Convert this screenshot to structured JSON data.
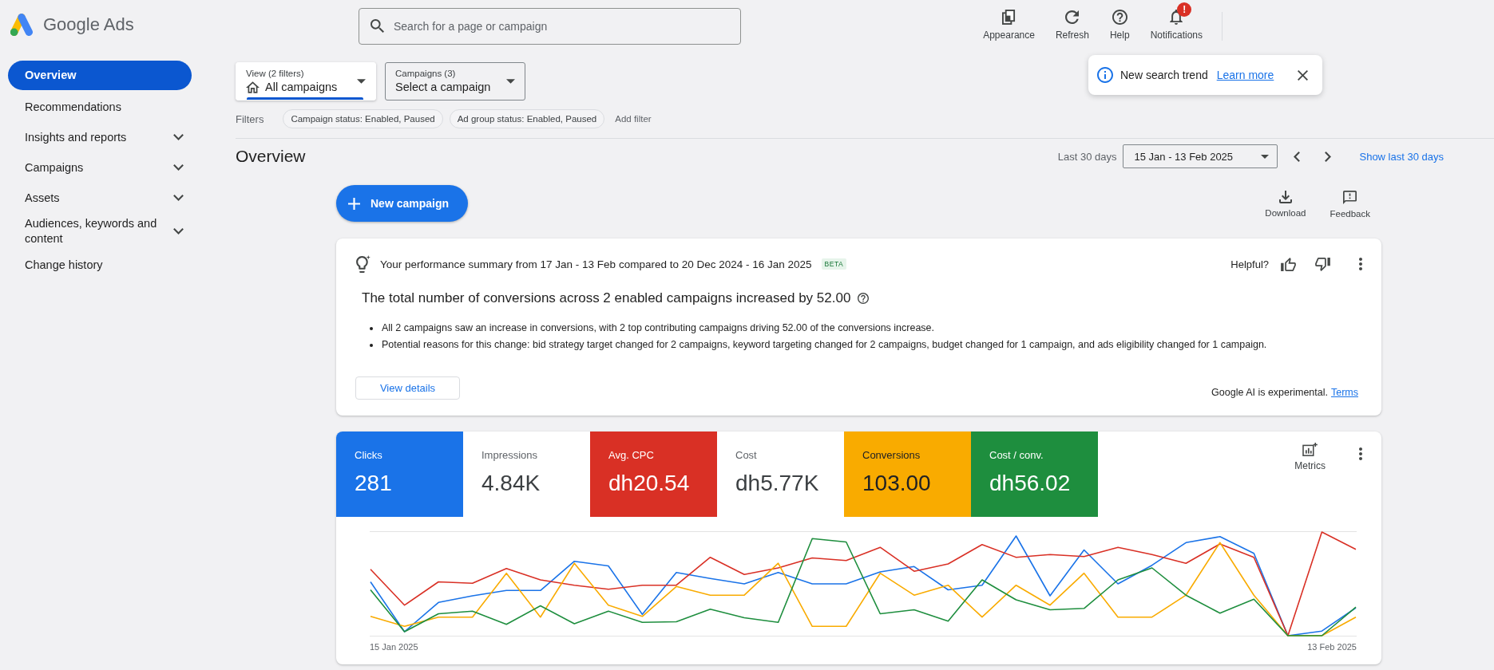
{
  "header": {
    "logo_text": "Google Ads",
    "search": {
      "placeholder": "Search for a page or campaign"
    },
    "actions": [
      {
        "kind": "appearance",
        "label": "Appearance"
      },
      {
        "kind": "refresh",
        "label": "Refresh"
      },
      {
        "kind": "help",
        "label": "Help"
      },
      {
        "kind": "notifications",
        "label": "Notifications",
        "badge": "!"
      }
    ]
  },
  "sidebar": {
    "items": [
      {
        "label": "Overview",
        "selected": true,
        "expandable": false
      },
      {
        "label": "Recommendations",
        "selected": false,
        "expandable": false
      },
      {
        "label": "Insights and reports",
        "selected": false,
        "expandable": true
      },
      {
        "label": "Campaigns",
        "selected": false,
        "expandable": true
      },
      {
        "label": "Assets",
        "selected": false,
        "expandable": true
      },
      {
        "label": "Audiences, keywords and content",
        "selected": false,
        "expandable": true
      },
      {
        "label": "Change history",
        "selected": false,
        "expandable": false
      }
    ]
  },
  "selectors": [
    {
      "kind": "view",
      "caption": "View (2 filters)",
      "value": "All campaigns",
      "selected": true
    },
    {
      "kind": "campaigns",
      "caption": "Campaigns (3)",
      "value": "Select a campaign",
      "selected": false
    }
  ],
  "filters": {
    "label": "Filters",
    "chips": [
      "Campaign status: Enabled, Paused",
      "Ad group status: Enabled, Paused"
    ],
    "add_label": "Add filter"
  },
  "toast": {
    "text": "New search trend",
    "link": "Learn more"
  },
  "page": {
    "title": "Overview",
    "range_label": "Last 30 days",
    "date_range": "15 Jan - 13 Feb 2025",
    "show_link": "Show last 30 days"
  },
  "toolbar": {
    "primary": "New campaign",
    "actions": [
      {
        "kind": "download",
        "label": "Download"
      },
      {
        "kind": "feedback",
        "label": "Feedback"
      }
    ]
  },
  "summary": {
    "title": "Your performance summary from 17 Jan - 13 Feb compared to 20 Dec 2024 - 16 Jan 2025",
    "badge": "BETA",
    "helpful_label": "Helpful?",
    "headline": "The total number of conversions across 2 enabled campaigns increased by 52.00",
    "bullets": [
      "All 2 campaigns saw an increase in conversions, with 2 top contributing campaigns driving 52.00 of the conversions increase.",
      "Potential reasons for this change: bid strategy target changed for 2 campaigns, keyword targeting changed for 2 campaigns, budget changed for 1 campaign, and ads eligibility changed for 1 campaign."
    ],
    "button": "View details",
    "disclaimer": "Google AI is experimental.",
    "link": "Terms"
  },
  "metrics": {
    "tiles": [
      {
        "label": "Clicks",
        "value": "281",
        "selected": true,
        "color": "#1a73e8"
      },
      {
        "label": "Impressions",
        "value": "4.84K",
        "selected": false
      },
      {
        "label": "Avg. CPC",
        "value": "dh20.54",
        "selected": true,
        "color": "#d93025"
      },
      {
        "label": "Cost",
        "value": "dh5.77K",
        "selected": false
      },
      {
        "label": "Conversions",
        "value": "103.00",
        "selected": true,
        "color": "#f9ab00"
      },
      {
        "label": "Cost / conv.",
        "value": "dh56.02",
        "selected": true,
        "color": "#1e8e3e"
      }
    ],
    "menu_label": "Metrics",
    "chart": {
      "start_label": "15 Jan 2025",
      "end_label": "13 Feb 2025"
    }
  }
}
